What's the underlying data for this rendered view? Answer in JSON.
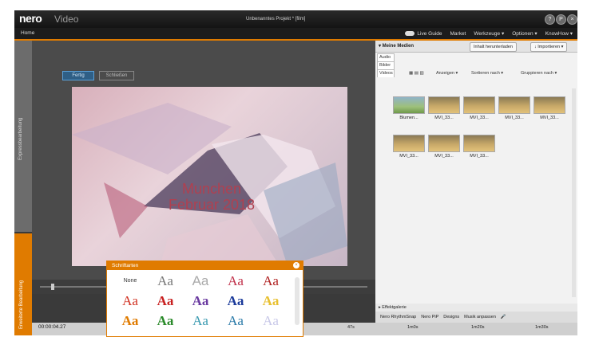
{
  "titlebar": {
    "logo": "nero",
    "product": "Video",
    "window_title": "Unbenanntes Projekt * [film]",
    "controls": [
      "?",
      "P",
      "×"
    ]
  },
  "menubar": {
    "home": "Home",
    "live_guide": "Live Guide",
    "market": "Market",
    "tools": "Werkzeuge ▾",
    "options": "Optionen ▾",
    "knowhow": "KnowHow ▾"
  },
  "left_tabs": {
    "top": "Expressbearbeitung",
    "bottom": "Erweiterte Bearbeitung"
  },
  "preview": {
    "done_button": "Fertig",
    "close_button": "Schließen",
    "title_line1": "Munchen",
    "title_line2": "Februar 2018"
  },
  "media": {
    "header": "▾ Meine Medien",
    "manage_button": "Inhalt herunterladen",
    "import_button": "↓ Importieren ▾",
    "filter_tabs": [
      "Audio",
      "Bilder",
      "Videos"
    ],
    "view_show": "Anzeigen ▾",
    "view_sort": "Sortieren nach ▾",
    "view_group": "Gruppieren nach ▾",
    "items": [
      {
        "label": "Blumen..."
      },
      {
        "label": "MVI_33..."
      },
      {
        "label": "MVI_33..."
      },
      {
        "label": "MVI_33..."
      },
      {
        "label": "MVI_33..."
      },
      {
        "label": "MVI_33..."
      },
      {
        "label": "MVI_33..."
      },
      {
        "label": "MVI_33..."
      }
    ]
  },
  "effects": {
    "label": "▸ Effektgalerie"
  },
  "timeline_toolbar": {
    "rhythm": "Nero RhythmSnap",
    "pip": "Nero PiP",
    "designs": "Designs",
    "music": "Musik anpassen"
  },
  "timeline": {
    "time": "00:00:04.27",
    "ticks": [
      "47s",
      "1m0s",
      "1m20s",
      "1m30s"
    ]
  },
  "fonts_panel": {
    "title": "Schriftarten",
    "none_label": "None",
    "sample": "Aa"
  },
  "colors": {
    "accent": "#e07b00",
    "title_red": "#b04050"
  }
}
